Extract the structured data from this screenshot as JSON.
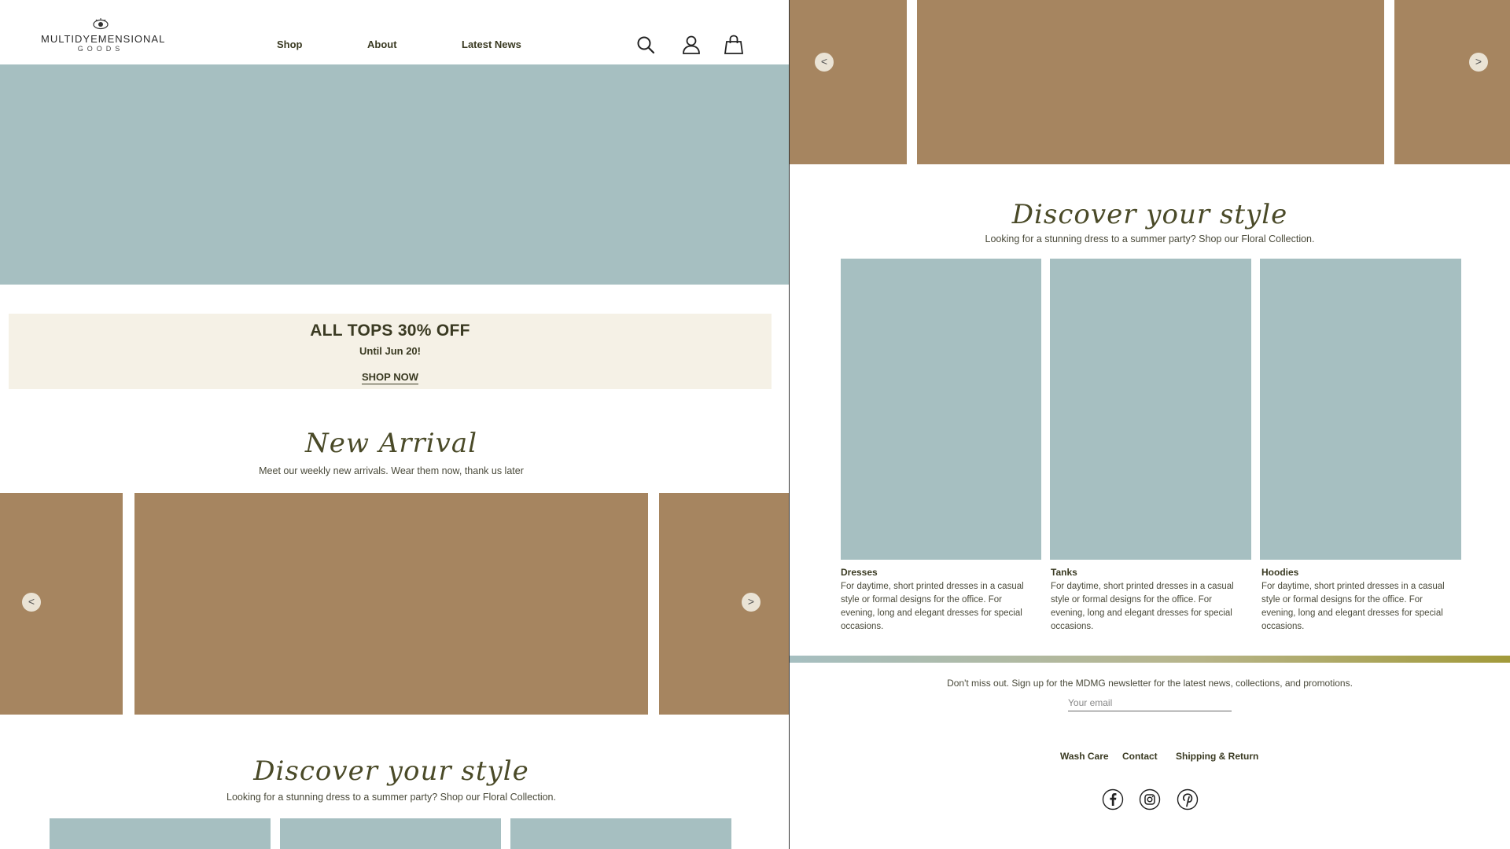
{
  "brand": {
    "line1": "MULTIDYEMENSIONAL",
    "line2": "GOODS"
  },
  "nav": {
    "shop": "Shop",
    "about": "About",
    "news": "Latest News"
  },
  "promo": {
    "title": "ALL TOPS 30% OFF",
    "subtitle": "Until Jun 20!",
    "cta": "SHOP NOW"
  },
  "new_arrival": {
    "title": "New Arrival",
    "subtitle": "Meet our weekly new arrivals. Wear them now, thank us later"
  },
  "carousel": {
    "prev": "<",
    "next": ">"
  },
  "discover": {
    "title": "Discover your style",
    "subtitle": "Looking for a stunning dress to a summer party? Shop our Floral Collection.",
    "cards": [
      {
        "title": "Dresses",
        "desc": "For daytime, short printed dresses in a casual style or formal designs for the office. For evening, long and elegant dresses for special occasions."
      },
      {
        "title": "Tanks",
        "desc": "For daytime, short printed dresses in a casual style or formal designs for the office. For evening, long and elegant dresses for special occasions."
      },
      {
        "title": "Hoodies",
        "desc": "For daytime, short printed dresses in a casual style or formal designs for the office. For evening, long and elegant dresses for special occasions."
      }
    ]
  },
  "newsletter": {
    "text": "Don't miss out. Sign up for the MDMG newsletter for the latest news, collections, and promotions.",
    "placeholder": "Your email"
  },
  "footer": {
    "wash": "Wash Care",
    "contact": "Contact",
    "shipping": "Shipping & Return"
  },
  "icons": {
    "search": "search-icon",
    "account": "user-icon",
    "cart": "shopping-bag-icon",
    "facebook": "facebook-icon",
    "instagram": "instagram-icon",
    "pinterest": "pinterest-icon"
  },
  "colors": {
    "hero_blue": "#a6bfc1",
    "product_tan": "#a68560",
    "promo_bg": "#f5f1e6",
    "text_olive": "#3a3a22"
  }
}
